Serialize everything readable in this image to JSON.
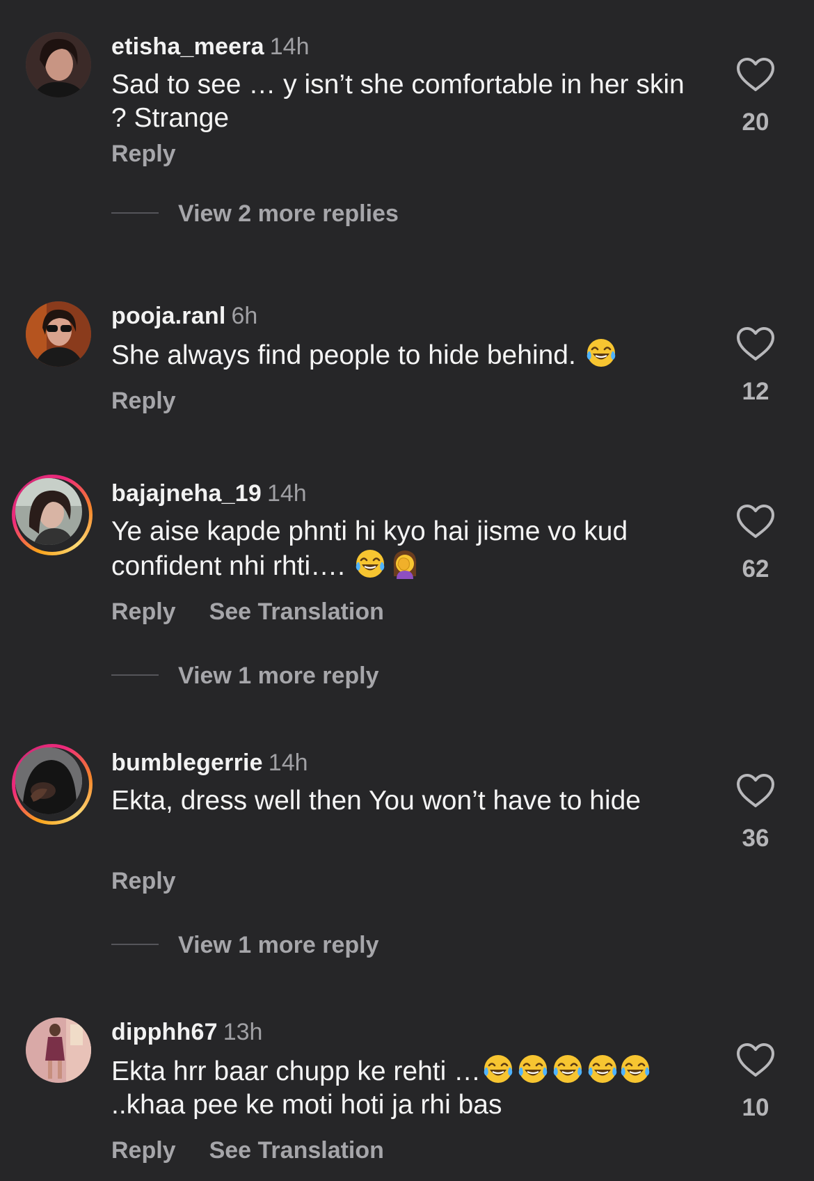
{
  "comments": [
    {
      "username": "etisha_meera",
      "time": "14h",
      "text": "Sad to see … y isn’t she comfortable in her skin ?  Strange",
      "likes": "20",
      "reply_label": "Reply",
      "more_replies": "View 2 more replies"
    },
    {
      "username": "pooja.ranl",
      "time": "6h",
      "text": "She always find people to hide behind.",
      "likes": "12",
      "reply_label": "Reply"
    },
    {
      "username": "bajajneha_19",
      "time": "14h",
      "text_part1": "Ye aise kapde phnti hi kyo hai jisme vo kud confident nhi rhti….",
      "likes": "62",
      "reply_label": "Reply",
      "translation_label": "See Translation",
      "more_replies": "View 1 more reply"
    },
    {
      "username": "bumblegerrie",
      "time": "14h",
      "text": "Ekta, dress well then You won’t have to hide",
      "likes": "36",
      "reply_label": "Reply",
      "more_replies": "View 1 more reply"
    },
    {
      "username": "dipphh67",
      "time": "13h",
      "text_part1": "Ekta hrr baar chupp ke rehti …",
      "text_part2": "..khaa pee ke moti hoti ja rhi bas",
      "likes": "10",
      "reply_label": "Reply",
      "translation_label": "See Translation"
    }
  ],
  "icons": {
    "like": "heart-outline-icon",
    "laugh_emoji": "face-with-tears-of-joy",
    "facepalm_emoji": "woman-facepalming"
  },
  "colors": {
    "background": "#262628",
    "primary_text": "#f4f4f4",
    "secondary_text": "#a6a6aa",
    "story_ring_start": "#f9a31b",
    "story_ring_end": "#ee2a7b"
  }
}
